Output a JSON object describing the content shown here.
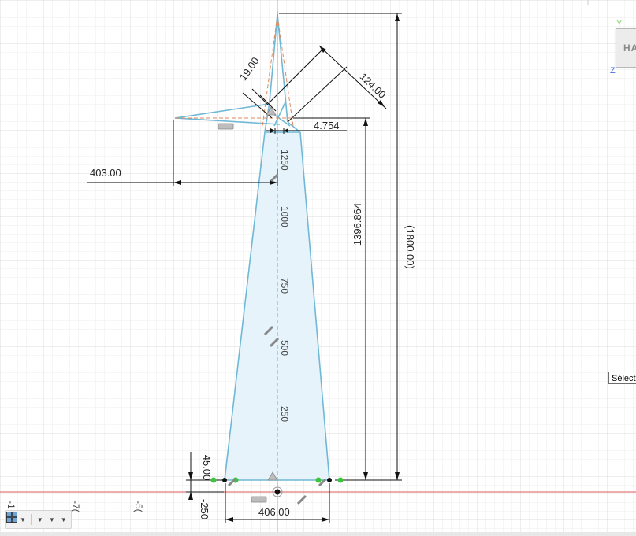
{
  "viewcube": {
    "face_label": "HA",
    "axis_y_label": "Y",
    "axis_z_label": "Z"
  },
  "tooltip": {
    "text": "Sélect"
  },
  "axis_ticks": [
    "-1",
    "-7(",
    "-5("
  ],
  "dimensions": {
    "d_19": "19.00",
    "d_124": "124.00",
    "d_4754": "4.754",
    "d_403": "403.00",
    "d_1396": "1396.864",
    "d_1800": "(1800.00)",
    "d_45": "45.00",
    "d_406": "406.00",
    "d_neg250": "-250"
  },
  "ruler_labels": [
    "1250",
    "1000",
    "750",
    "500",
    "250"
  ],
  "toolbar": {
    "items": [
      {
        "name": "pan-tool",
        "icon": "hand-icon"
      },
      {
        "name": "zoom-tool",
        "icon": "zoom-icon"
      },
      {
        "name": "fit-tool",
        "icon": "zoom-window-icon"
      },
      {
        "name": "display-settings",
        "icon": "monitor-icon"
      },
      {
        "name": "grid-settings",
        "icon": "grid-icon"
      },
      {
        "name": "viewports",
        "icon": "viewports-icon"
      }
    ]
  },
  "colors": {
    "sketch_line": "#6fb8d6",
    "sketch_fill": "#e6f3fa",
    "construction": "#e08a5a",
    "grid": "#e3e3e3",
    "origin_axis_x": "#e05a5a",
    "origin_axis_y": "#7ecf6a",
    "dimension": "#111111",
    "constraint_point_green": "#3cc43c"
  }
}
